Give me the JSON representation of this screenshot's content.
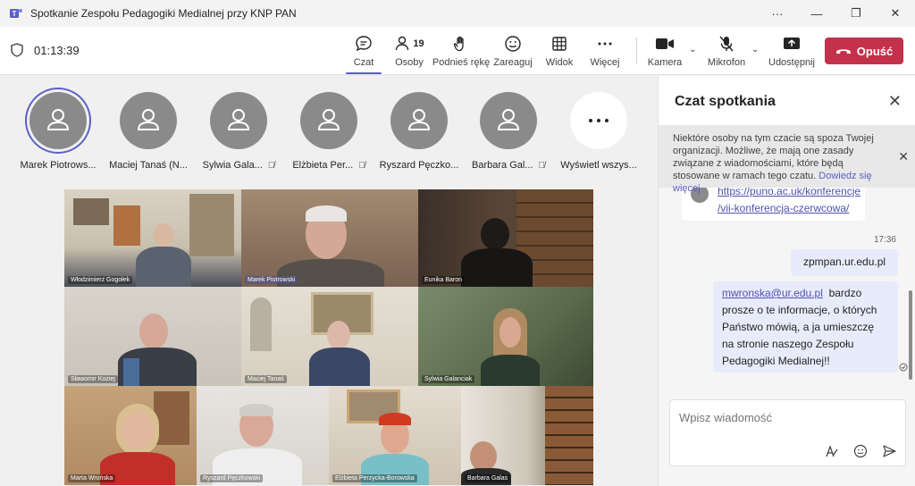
{
  "window": {
    "title": "Spotkanie Zespołu Pedagogiki Medialnej przy KNP PAN",
    "controls": {
      "more": "···",
      "minimize": "—",
      "restore": "❐",
      "close": "✕"
    }
  },
  "toolbar": {
    "timer": "01:13:39",
    "chat_label": "Czat",
    "people_label": "Osoby",
    "people_count": "19",
    "raise_hand_label": "Podnieś rękę",
    "react_label": "Zareaguj",
    "view_label": "Widok",
    "more_label": "Więcej",
    "camera_label": "Kamera",
    "mic_label": "Mikrofon",
    "share_label": "Udostępnij",
    "leave_label": "Opuść"
  },
  "participants": [
    {
      "name": "Marek Piotrows...",
      "active": true,
      "muted": false
    },
    {
      "name": "Maciej Tanaś (N...",
      "active": false,
      "muted": false
    },
    {
      "name": "Sylwia Gala...",
      "active": false,
      "muted": true
    },
    {
      "name": "Elżbieta Per...",
      "active": false,
      "muted": true
    },
    {
      "name": "Ryszard Pęczko...",
      "active": false,
      "muted": false
    },
    {
      "name": "Barbara Gal...",
      "active": false,
      "muted": true
    },
    {
      "name": "Wyświetl wszys...",
      "active": false,
      "muted": false
    }
  ],
  "video_tiles": [
    {
      "name": "Włodzimierz Gogołek"
    },
    {
      "name": "Marek Piotrowski"
    },
    {
      "name": "Eunika Baron"
    },
    {
      "name": "Sławomir Koziej"
    },
    {
      "name": "Maciej Tanaś"
    },
    {
      "name": "Sylwia Galanciak"
    },
    {
      "name": "Marta Wrońska"
    },
    {
      "name": "Ryszard Pęczkowski"
    },
    {
      "name": "Elżbieta Perzycka-Borowska"
    },
    {
      "name": "Barbara Galas"
    }
  ],
  "chat": {
    "title": "Czat spotkania",
    "notice": "Niektóre osoby na tym czacie są spoza Twojej organizacji. Możliwe, że mają one zasady związane z wiadomościami, które będą stosowane w ramach tego czatu.",
    "notice_link": "Dowiedz się więcej",
    "msg1_link_line1": "https://puno.ac.uk/konferencje",
    "msg1_link_line2": "/vii-konferencja-czerwcowa/",
    "time": "17:36",
    "msg2": "zpmpan.ur.edu.pl",
    "msg3_link": "mwronska@ur.edu.pl",
    "msg3_line1": "bardzo",
    "msg3_line2": "prosze o te informacje, o których",
    "msg3_line3": "Państwo mówią, a ja umieszczę",
    "msg3_line4": "na stronie naszego Zespołu",
    "msg3_line5": "Pedagogiki Medialnej!!",
    "compose_placeholder": "Wpisz wiadomość"
  },
  "colors": {
    "accent": "#5b5fc7",
    "leave": "#c4314b",
    "out_bubble": "#e8ebfa"
  }
}
